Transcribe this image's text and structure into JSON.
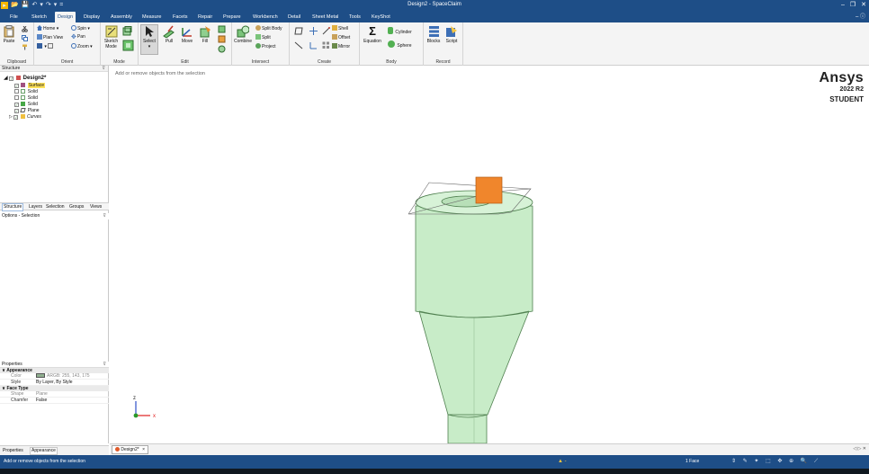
{
  "window": {
    "title": "Design2 - SpaceClaim",
    "minimize": "–",
    "restore": "❐",
    "close": "✕",
    "help": "– ⓘ"
  },
  "quick_access": [
    "▾",
    "📂",
    "💾",
    "↶",
    "▾",
    "↷",
    "▾",
    "="
  ],
  "tabs": [
    "File",
    "Sketch",
    "Design",
    "Display",
    "Assembly",
    "Measure",
    "Facets",
    "Repair",
    "Prepare",
    "Workbench",
    "Detail",
    "Sheet Metal",
    "Tools",
    "KeyShot"
  ],
  "active_tab": "Design",
  "ribbon": {
    "groups": {
      "clipboard": "Clipboard",
      "orient": "Orient",
      "mode": "Mode",
      "edit": "Edit",
      "intersect": "Intersect",
      "create": "Create",
      "body": "Body",
      "record": "Record"
    },
    "paste": "Paste",
    "home": "Home",
    "spin": "Spin",
    "plan_view": "Plan View",
    "pan": "Pan",
    "zoom": "Zoom",
    "sketch_mode": "Sketch Mode",
    "select": "Select",
    "pull": "Pull",
    "move": "Move",
    "fill": "Fill",
    "combine": "Combine",
    "split_body": "Split Body",
    "split": "Split",
    "project": "Project",
    "shell": "Shell",
    "offset": "Offset",
    "mirror": "Mirror",
    "equation": "Equation",
    "cylinder": "Cylinder",
    "sphere": "Sphere",
    "blocks": "Blocks",
    "script": "Script"
  },
  "structure": {
    "header": "Structure",
    "items": [
      {
        "label": "Design2*",
        "bold": true
      },
      {
        "label": "Surface",
        "selected": true
      },
      {
        "label": "Solid"
      },
      {
        "label": "Solid"
      },
      {
        "label": "Solid"
      },
      {
        "label": "Plane"
      },
      {
        "label": "Curves",
        "italic": true
      }
    ]
  },
  "panel_tabs": [
    "Structure",
    "Layers",
    "Selection",
    "Groups",
    "Views"
  ],
  "options_header": "Options - Selection",
  "properties": {
    "header": "Properties",
    "appearance": "Appearance",
    "color_key": "Color",
    "color_value": "ARGB: 255, 143, 175",
    "style_key": "Style",
    "style_value": "By Layer, By Style",
    "face_type": "Face Type",
    "shape_key": "Shape",
    "shape_value": "Plane",
    "chamfer_key": "Chamfer",
    "chamfer_value": "False"
  },
  "bottom_tabs": [
    "Properties",
    "Appearance"
  ],
  "viewport": {
    "hint": "Add or remove objects from the selection",
    "brand_name": "Ansys",
    "brand_year": "2022 R2",
    "brand_edition": "STUDENT",
    "axis_z": "z",
    "axis_x": "x"
  },
  "doc_tab": "Design2*",
  "doc_tab_close": "×",
  "doc_nav": "◁ ▷ ✕",
  "status": {
    "message": "Add or remove objects from the selection",
    "warning": "▲ -",
    "selection_count": "1 Face",
    "tools": "⇕ ✎ ✦ ⬚ ✥ ⊕ 🔍 ⟋"
  },
  "colors": {
    "title_bar": "#1e4e87",
    "body_fill": "#c8ecc8",
    "body_stroke": "#5a8a5a",
    "surface": "#f0862c"
  }
}
